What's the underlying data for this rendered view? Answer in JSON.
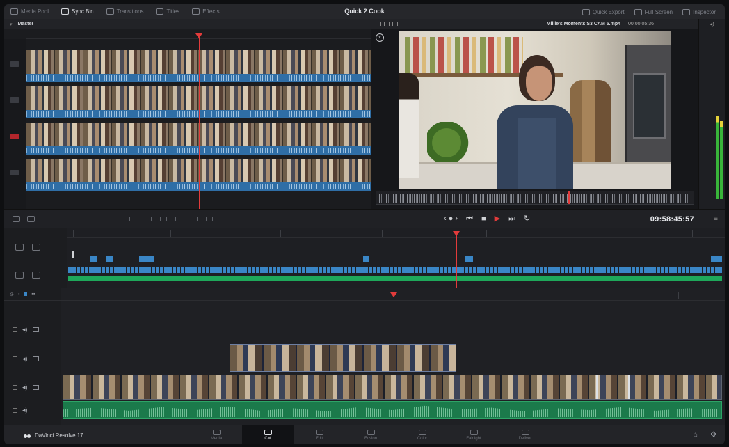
{
  "toolbar": {
    "tools": [
      {
        "label": "Media Pool",
        "active": false
      },
      {
        "label": "Sync Bin",
        "active": true
      },
      {
        "label": "Transitions",
        "active": false
      },
      {
        "label": "Titles",
        "active": false
      },
      {
        "label": "Effects",
        "active": false
      }
    ],
    "project_title": "Quick 2 Cook",
    "right": [
      {
        "label": "Quick Export"
      },
      {
        "label": "Full Screen"
      },
      {
        "label": "Inspector"
      }
    ]
  },
  "source": {
    "bin_label": "Master"
  },
  "viewer": {
    "clip_name": "Millie's Moments S3 CAM 5.mp4",
    "duration": "00:00:05:36"
  },
  "transport": {
    "timecode": "09:58:45:57"
  },
  "pages": [
    {
      "label": "Media",
      "active": false
    },
    {
      "label": "Cut",
      "active": true
    },
    {
      "label": "Edit",
      "active": false
    },
    {
      "label": "Fusion",
      "active": false
    },
    {
      "label": "Color",
      "active": false
    },
    {
      "label": "Fairlight",
      "active": false
    },
    {
      "label": "Deliver",
      "active": false
    }
  ],
  "brand": {
    "name": "DaVinci Resolve 17"
  },
  "colors": {
    "accent": "#e23b3b",
    "audio_blue": "#3a86c6",
    "audio_green": "#1ea85a"
  }
}
